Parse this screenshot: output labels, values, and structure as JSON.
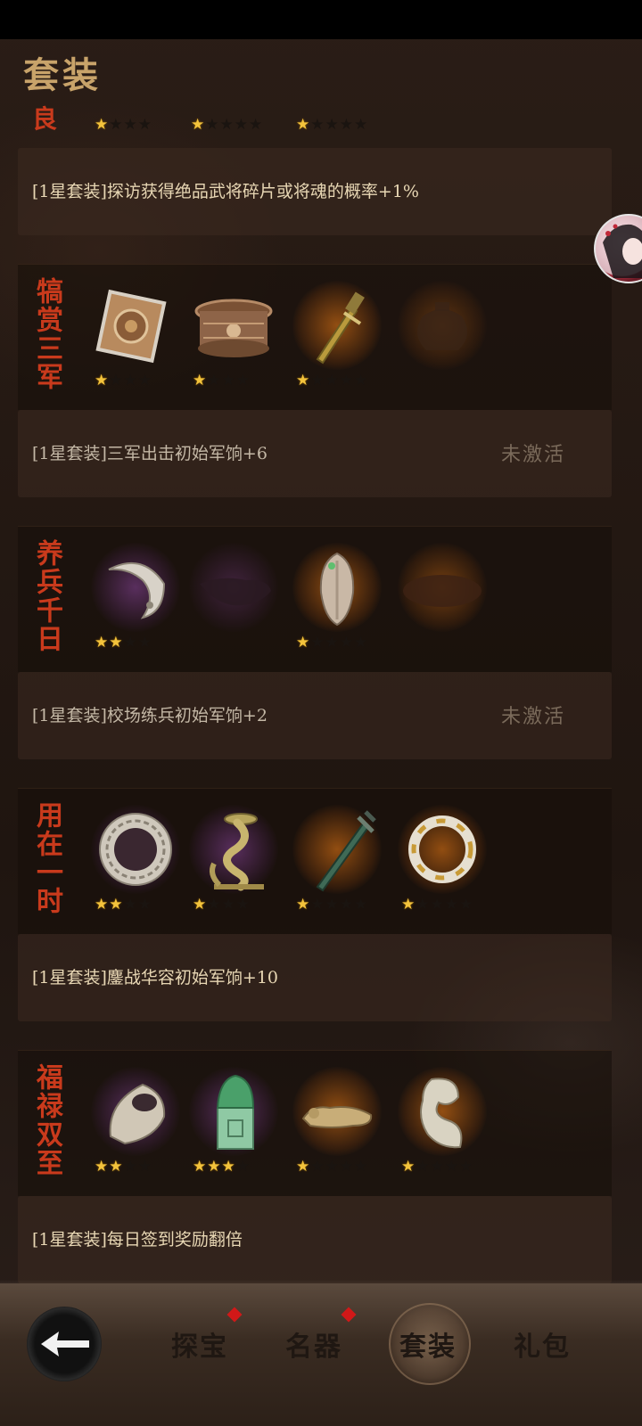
{
  "page": {
    "title": "套装"
  },
  "top_partial": {
    "name": "良",
    "items": [
      {
        "stars": 1,
        "max": 4
      },
      {
        "stars": 1,
        "max": 5
      },
      {
        "stars": 1,
        "max": 5
      }
    ],
    "effect": "[1星套装]探访获得绝品武将碎片或将魂的概率+1%"
  },
  "sets": [
    {
      "name": "犒赏三军",
      "items": [
        {
          "icon": "bronze-mirror-icon",
          "glow": "none",
          "stars": 1,
          "max": 4
        },
        {
          "icon": "bronze-drum-base-icon",
          "glow": "none",
          "stars": 1,
          "max": 4
        },
        {
          "icon": "bronze-dagger-icon",
          "glow": "orange",
          "stars": 1,
          "max": 5
        },
        {
          "icon": "locked-vessel-icon",
          "glow": "orange",
          "stars": 0,
          "max": 0
        }
      ],
      "effect": "[1星套装]三军出击初始军饷+6",
      "status": "未激活"
    },
    {
      "name": "养兵千日",
      "items": [
        {
          "icon": "jade-dragon-pendant-icon",
          "glow": "purple",
          "stars": 2,
          "max": 4
        },
        {
          "icon": "locked-relic-icon",
          "glow": "purple",
          "stars": 0,
          "max": 0
        },
        {
          "icon": "jade-bi-pendant-icon",
          "glow": "orange",
          "stars": 1,
          "max": 5
        },
        {
          "icon": "locked-plate-icon",
          "glow": "orange",
          "stars": 0,
          "max": 0
        }
      ],
      "effect": "[1星套装]校场练兵初始军饷+2",
      "status": "未激活"
    },
    {
      "name": "用在一时",
      "items": [
        {
          "icon": "jade-ring-disc-icon",
          "glow": "purple",
          "stars": 2,
          "max": 4
        },
        {
          "icon": "bronze-dragon-lamp-icon",
          "glow": "purple",
          "stars": 1,
          "max": 4
        },
        {
          "icon": "bronze-sword-icon",
          "glow": "orange",
          "stars": 1,
          "max": 5
        },
        {
          "icon": "jade-gold-bracelet-icon",
          "glow": "orange",
          "stars": 1,
          "max": 5
        }
      ],
      "effect": "[1星套装]鏖战华容初始军饷+10",
      "status": ""
    },
    {
      "name": "福禄双至",
      "items": [
        {
          "icon": "silver-thumb-ring-icon",
          "glow": "purple",
          "stars": 2,
          "max": 4
        },
        {
          "icon": "jade-lion-seal-icon",
          "glow": "purple",
          "stars": 3,
          "max": 4
        },
        {
          "icon": "bronze-tiger-tally-icon",
          "glow": "orange",
          "stars": 1,
          "max": 5
        },
        {
          "icon": "jade-dragon-ornament-icon",
          "glow": "orange",
          "stars": 1,
          "max": 5
        }
      ],
      "effect": "[1星套装]每日签到奖励翻倍",
      "status": ""
    }
  ],
  "tabbar": {
    "back_icon": "back-arrow-icon",
    "tabs": [
      {
        "label": "探宝",
        "badge": true,
        "active": false
      },
      {
        "label": "名器",
        "badge": true,
        "active": false
      },
      {
        "label": "套装",
        "badge": false,
        "active": true
      },
      {
        "label": "礼包",
        "badge": false,
        "active": false
      }
    ]
  },
  "colors": {
    "set_name": "#c93a1c",
    "star_on": "#f3c33c",
    "badge": "#d11818",
    "title": "#c8a36a"
  }
}
